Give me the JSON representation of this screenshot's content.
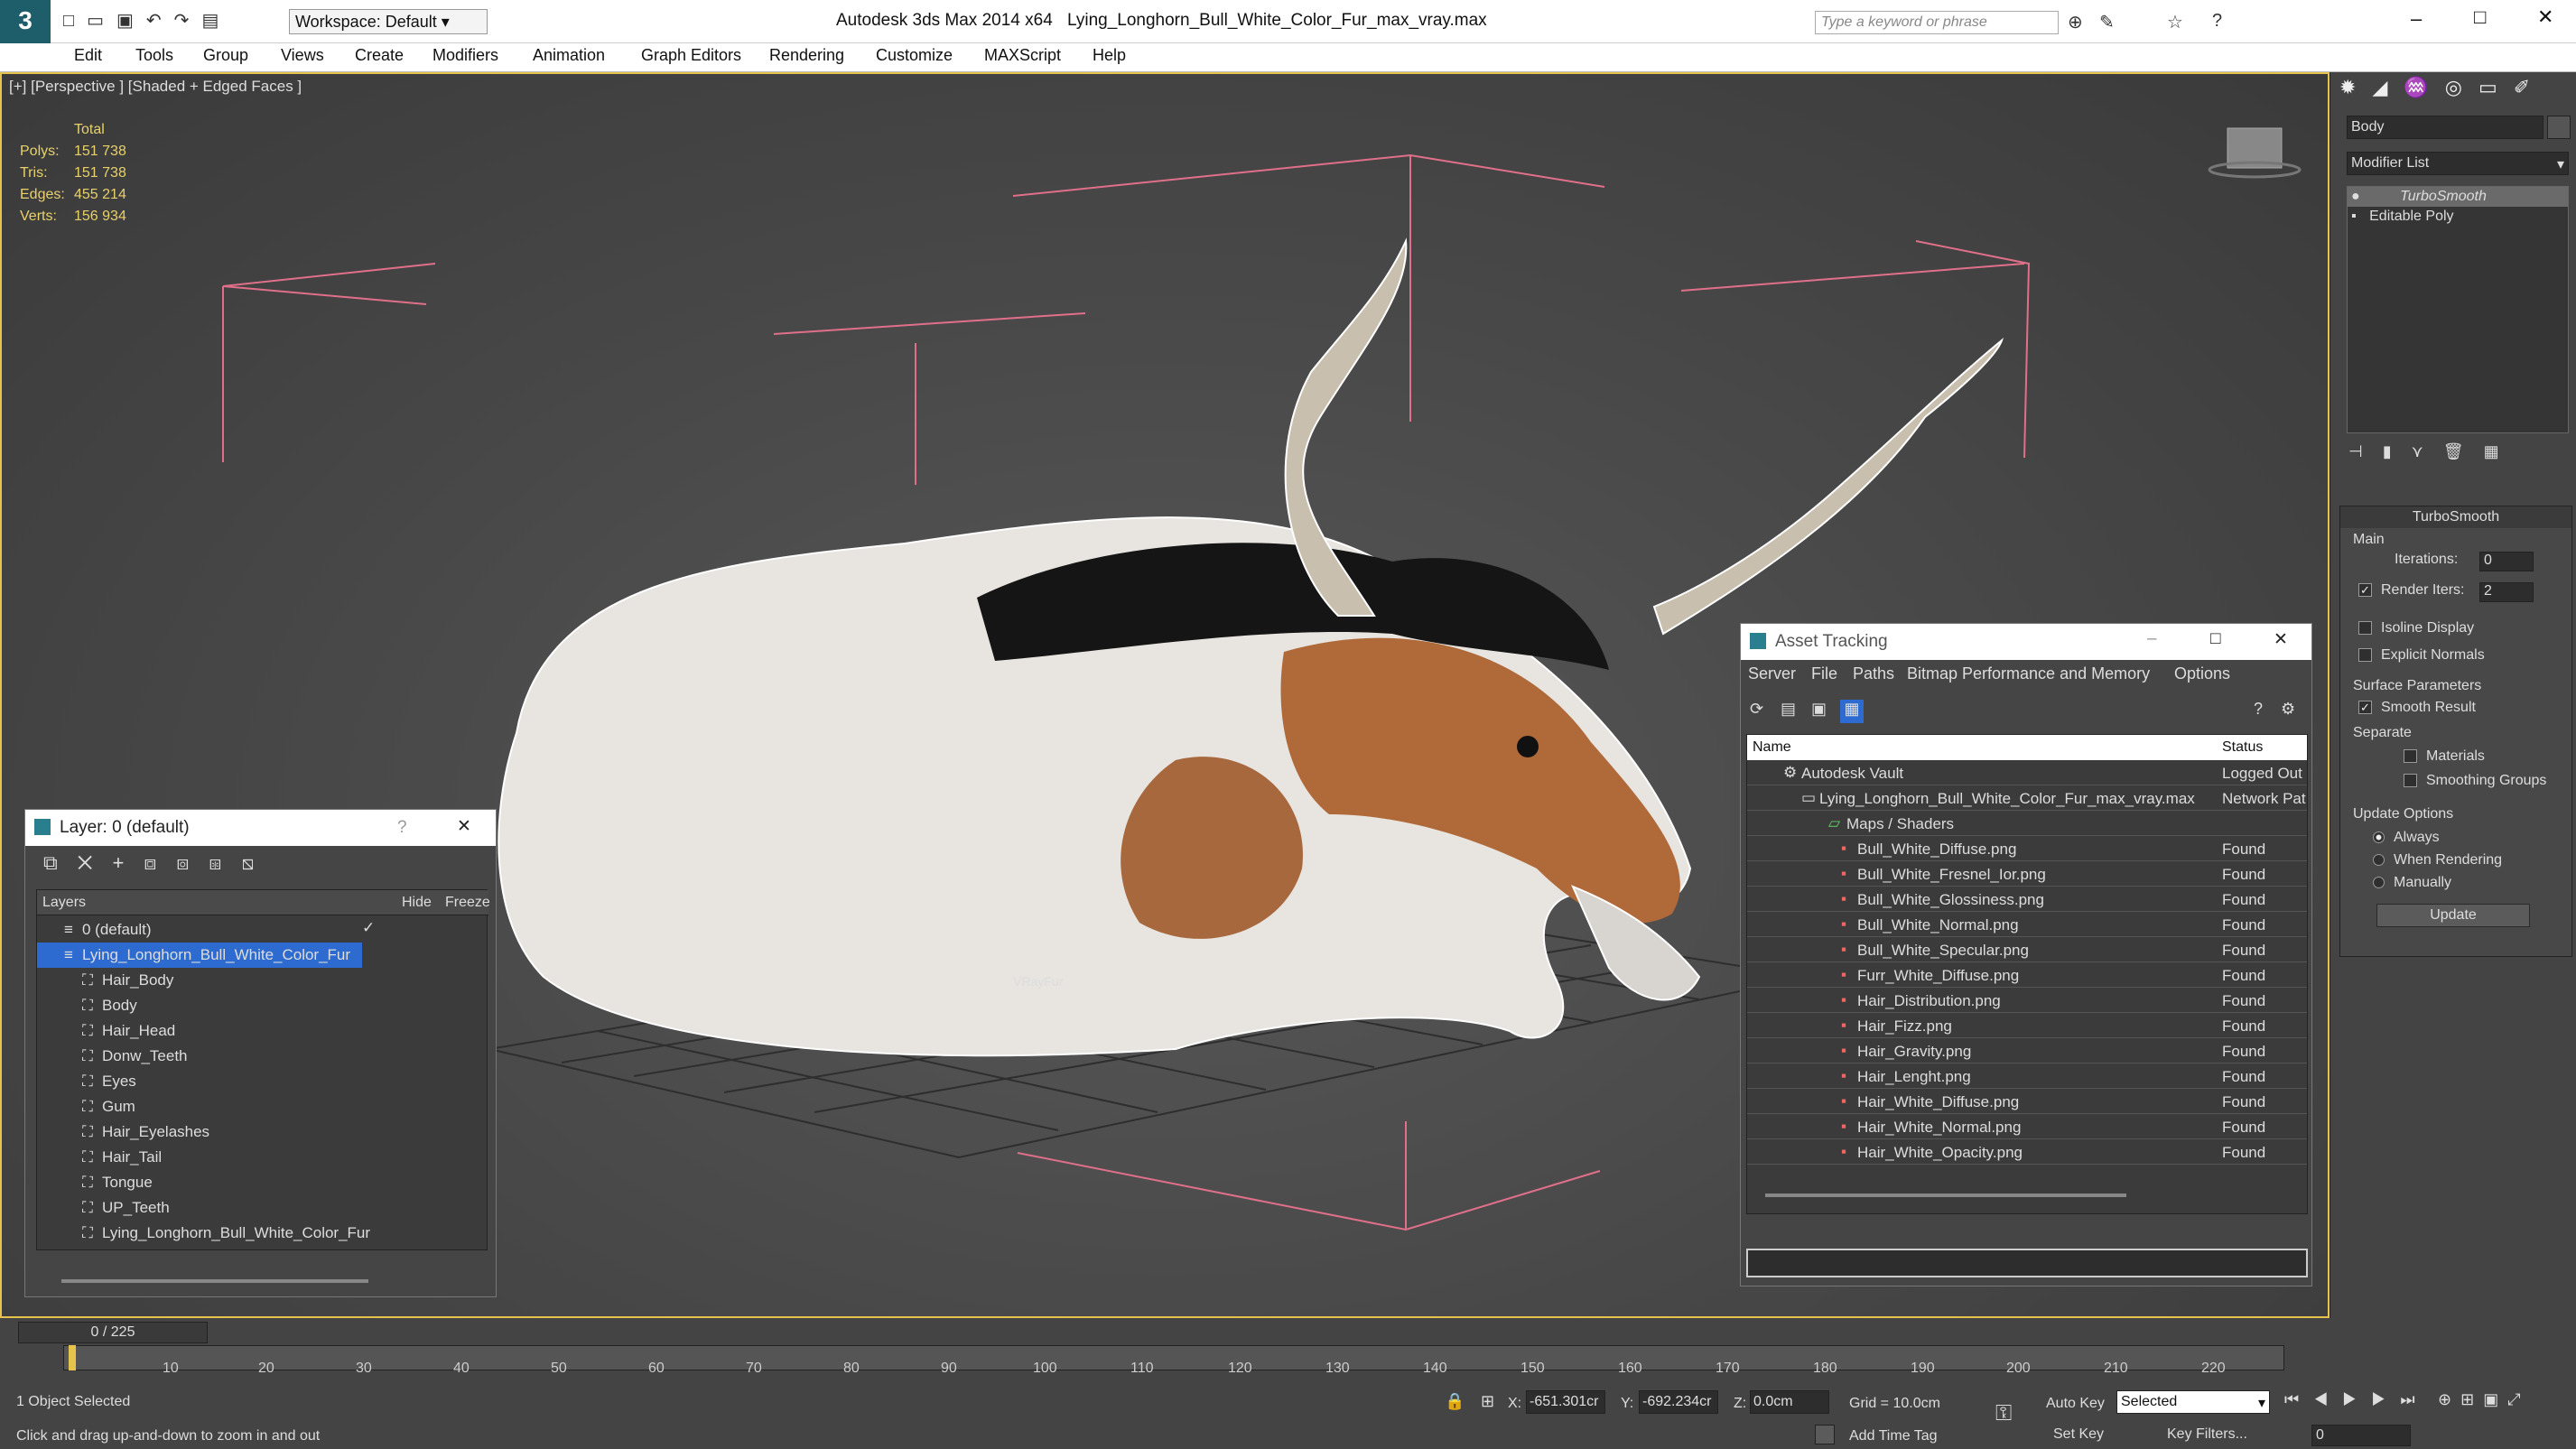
{
  "titlebar": {
    "app": "Autodesk 3ds Max  2014 x64",
    "file": "Lying_Longhorn_Bull_White_Color_Fur_max_vray.max",
    "workspace": "Workspace: Default",
    "search_placeholder": "Type a keyword or phrase"
  },
  "menu": [
    "Edit",
    "Tools",
    "Group",
    "Views",
    "Create",
    "Modifiers",
    "Animation",
    "Graph Editors",
    "Rendering",
    "Customize",
    "MAXScript",
    "Help"
  ],
  "viewport": {
    "label": "[+] [Perspective ] [Shaded + Edged Faces ]",
    "fur_label": "VRayFur",
    "stats": {
      "header": "Total",
      "rows": [
        {
          "k": "Polys:",
          "v": "151 738"
        },
        {
          "k": "Tris:",
          "v": "151 738"
        },
        {
          "k": "Edges:",
          "v": "455 214"
        },
        {
          "k": "Verts:",
          "v": "156 934"
        }
      ]
    }
  },
  "layer_window": {
    "title": "Layer: 0 (default)",
    "help": "?",
    "col_layers": "Layers",
    "col_hide": "Hide",
    "col_freeze": "Freeze",
    "rows": [
      "0 (default)",
      "Lying_Longhorn_Bull_White_Color_Fur",
      "Hair_Body",
      "Body",
      "Hair_Head",
      "Donw_Teeth",
      "Eyes",
      "Gum",
      "Hair_Eyelashes",
      "Hair_Tail",
      "Tongue",
      "UP_Teeth",
      "Lying_Longhorn_Bull_White_Color_Fur"
    ]
  },
  "asset_window": {
    "title": "Asset Tracking",
    "menu": [
      "Server",
      "File",
      "Paths",
      "Bitmap Performance and Memory",
      "Options"
    ],
    "col_name": "Name",
    "col_status": "Status",
    "rows": [
      {
        "name": "Autodesk Vault",
        "status": "Logged Out"
      },
      {
        "name": "Lying_Longhorn_Bull_White_Color_Fur_max_vray.max",
        "status": "Network Pat"
      },
      {
        "name": "Maps / Shaders",
        "status": ""
      },
      {
        "name": "Bull_White_Diffuse.png",
        "status": "Found"
      },
      {
        "name": "Bull_White_Fresnel_Ior.png",
        "status": "Found"
      },
      {
        "name": "Bull_White_Glossiness.png",
        "status": "Found"
      },
      {
        "name": "Bull_White_Normal.png",
        "status": "Found"
      },
      {
        "name": "Bull_White_Specular.png",
        "status": "Found"
      },
      {
        "name": "Furr_White_Diffuse.png",
        "status": "Found"
      },
      {
        "name": "Hair_Distribution.png",
        "status": "Found"
      },
      {
        "name": "Hair_Fizz.png",
        "status": "Found"
      },
      {
        "name": "Hair_Gravity.png",
        "status": "Found"
      },
      {
        "name": "Hair_Lenght.png",
        "status": "Found"
      },
      {
        "name": "Hair_White_Diffuse.png",
        "status": "Found"
      },
      {
        "name": "Hair_White_Normal.png",
        "status": "Found"
      },
      {
        "name": "Hair_White_Opacity.png",
        "status": "Found"
      }
    ]
  },
  "command_panel": {
    "object_name": "Body",
    "modifier_list": "Modifier List",
    "stack": [
      "TurboSmooth",
      "Editable Poly"
    ],
    "rollout": "TurboSmooth",
    "main": "Main",
    "iterations_label": "Iterations:",
    "iterations": "0",
    "render_iters_label": "Render Iters:",
    "render_iters": "2",
    "isoline": "Isoline Display",
    "explicit": "Explicit Normals",
    "surface": "Surface Parameters",
    "smooth": "Smooth Result",
    "separate": "Separate",
    "materials": "Materials",
    "smoothing": "Smoothing Groups",
    "update_opts": "Update Options",
    "always": "Always",
    "when_rendering": "When Rendering",
    "manually": "Manually",
    "update_btn": "Update"
  },
  "timeline": {
    "frame": "0 / 225",
    "ticks": [
      "10",
      "20",
      "30",
      "40",
      "50",
      "60",
      "70",
      "80",
      "90",
      "100",
      "110",
      "120",
      "130",
      "140",
      "150",
      "160",
      "170",
      "180",
      "190",
      "200",
      "210",
      "220"
    ]
  },
  "statusbar": {
    "selected": "1 Object Selected",
    "hint": "Click and drag up-and-down to zoom in and out",
    "x_label": "X:",
    "x": "-651.301cr",
    "y_label": "Y:",
    "y": "-692.234cr",
    "z_label": "Z:",
    "z": "0.0cm",
    "grid": "Grid = 10.0cm",
    "auto_key": "Auto Key",
    "set_key": "Set Key",
    "selected_dd": "Selected",
    "key_filters": "Key Filters...",
    "add_time_tag": "Add Time Tag",
    "frame_field": "0"
  }
}
